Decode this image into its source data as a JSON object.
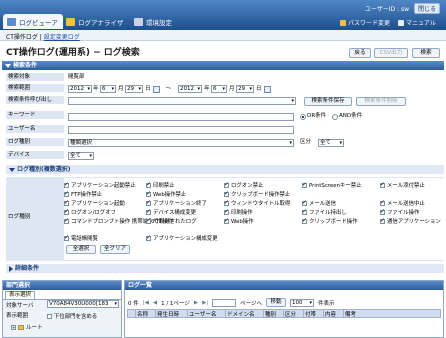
{
  "topnav": {
    "tabs": [
      {
        "label": "ログビューア"
      },
      {
        "label": "ログアナライザ"
      },
      {
        "label": "環境設定"
      }
    ],
    "user_label": "ユーザーID : sw",
    "logout": "閉じる",
    "links": {
      "password": "パスワード変更",
      "manual": "マニュアル"
    }
  },
  "breadcrumb": {
    "current": "CT操作ログ",
    "sep": "|",
    "link": "設定変更ログ"
  },
  "page": {
    "title": "CT操作ログ(運用系) − ログ検索",
    "buttons": {
      "back": "戻る",
      "csv": "CSV出力",
      "search": "検索"
    }
  },
  "search": {
    "header": "検索条件",
    "target_label": "検索対象",
    "target_value": "閲覧部",
    "range_label": "検索範囲",
    "range": {
      "from_year": "2012",
      "from_month": "6",
      "from_day": "29",
      "to_year": "2012",
      "to_month": "6",
      "to_day": "29",
      "year_unit": "年",
      "month_unit": "月",
      "day_unit": "日",
      "tilde": "～"
    },
    "saved_label": "検索条件呼び出し",
    "saved_save": "検索条件保存",
    "saved_delete": "検索条件削除",
    "keyword_label": "キーワード",
    "or_label": "OR条件",
    "and_label": "AND条件",
    "user_label": "ユーザー名",
    "logtype_label": "ログ種別",
    "logtype_value": "種類選択",
    "kubun_label": "区分",
    "kubun_value": "全て",
    "device_label": "デバイス",
    "device_value": "全て"
  },
  "logtypes": {
    "header": "ログ種別(複数選択)",
    "label": "ログ種別",
    "items": [
      "アプリケーション起動禁止",
      "印刷禁止",
      "ログオン禁止",
      "PrintScreenキー禁止",
      "メール添付禁止",
      "FTP操作禁止",
      "Web操作禁止",
      "クリップボード操作禁止",
      "アプリケーション起動",
      "アプリケーション終了",
      "ウィンドウタイトル取得",
      "メール送信",
      "メール送信中止",
      "ログオン/ログオフ",
      "デバイス構成変更",
      "印刷操作",
      "ファイル持出し",
      "ファイル操作",
      "コマンドプロンプト操作 携帯端末で取得されたログ",
      "FTP操作",
      "Web操作",
      "クリップボード操作",
      "通信アプリケーション",
      "電話帳閲覧",
      "アプリケーション構成変更"
    ],
    "select_all": "全選択",
    "clear_all": "全クリア"
  },
  "detail": {
    "header": "詳細条件"
  },
  "dept": {
    "header": "部門選択",
    "tab": "表示選択",
    "server_label": "対象サーバ",
    "server_value": "V70A84V30U000[183",
    "view_label": "表示範囲",
    "sub_label": "下位部門を含める",
    "root": "ルート"
  },
  "loglist": {
    "header": "ログ一覧",
    "count_prefix": "0 件",
    "page_info": "1 / 1ページ",
    "page_goto": "ページへ",
    "move": "移動",
    "per_page": "100",
    "per_page_unit": "件表示",
    "columns": [
      "名称",
      "発生日時",
      "ユーザー名",
      "ドメイン名",
      "種別",
      "区分",
      "付帯",
      "内容",
      "備考"
    ]
  }
}
